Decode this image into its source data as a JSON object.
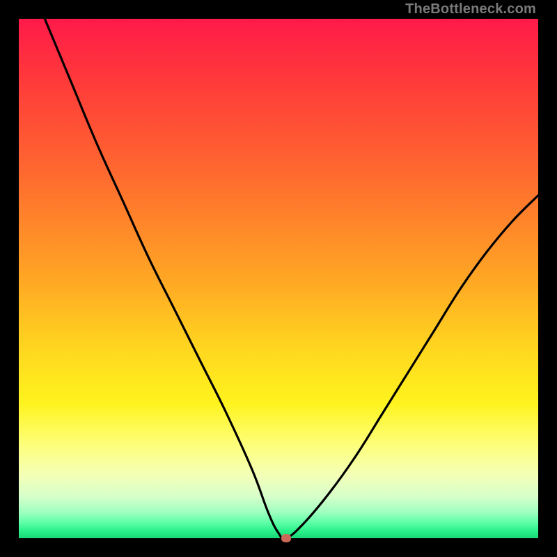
{
  "watermark": "TheBottleneck.com",
  "chart_data": {
    "type": "line",
    "title": "",
    "xlabel": "",
    "ylabel": "",
    "xlim": [
      0,
      100
    ],
    "ylim": [
      0,
      100
    ],
    "grid": false,
    "legend": false,
    "series": [
      {
        "name": "bottleneck-curve",
        "x": [
          5,
          10,
          15,
          20,
          25,
          30,
          35,
          40,
          45,
          48,
          50,
          51.5,
          55,
          60,
          65,
          70,
          75,
          80,
          85,
          90,
          95,
          100
        ],
        "values": [
          100,
          88,
          76,
          65,
          54,
          44,
          34,
          24,
          13,
          5,
          1,
          0,
          3,
          9,
          16,
          24,
          32,
          40,
          48,
          55,
          61,
          66
        ]
      }
    ],
    "marker": {
      "x": 51.5,
      "y": 0,
      "color": "#cc6a59"
    },
    "background": "sunset-gradient",
    "colors": {
      "top": "#ff1a49",
      "bottom": "#16d877",
      "curve": "#000000"
    }
  }
}
